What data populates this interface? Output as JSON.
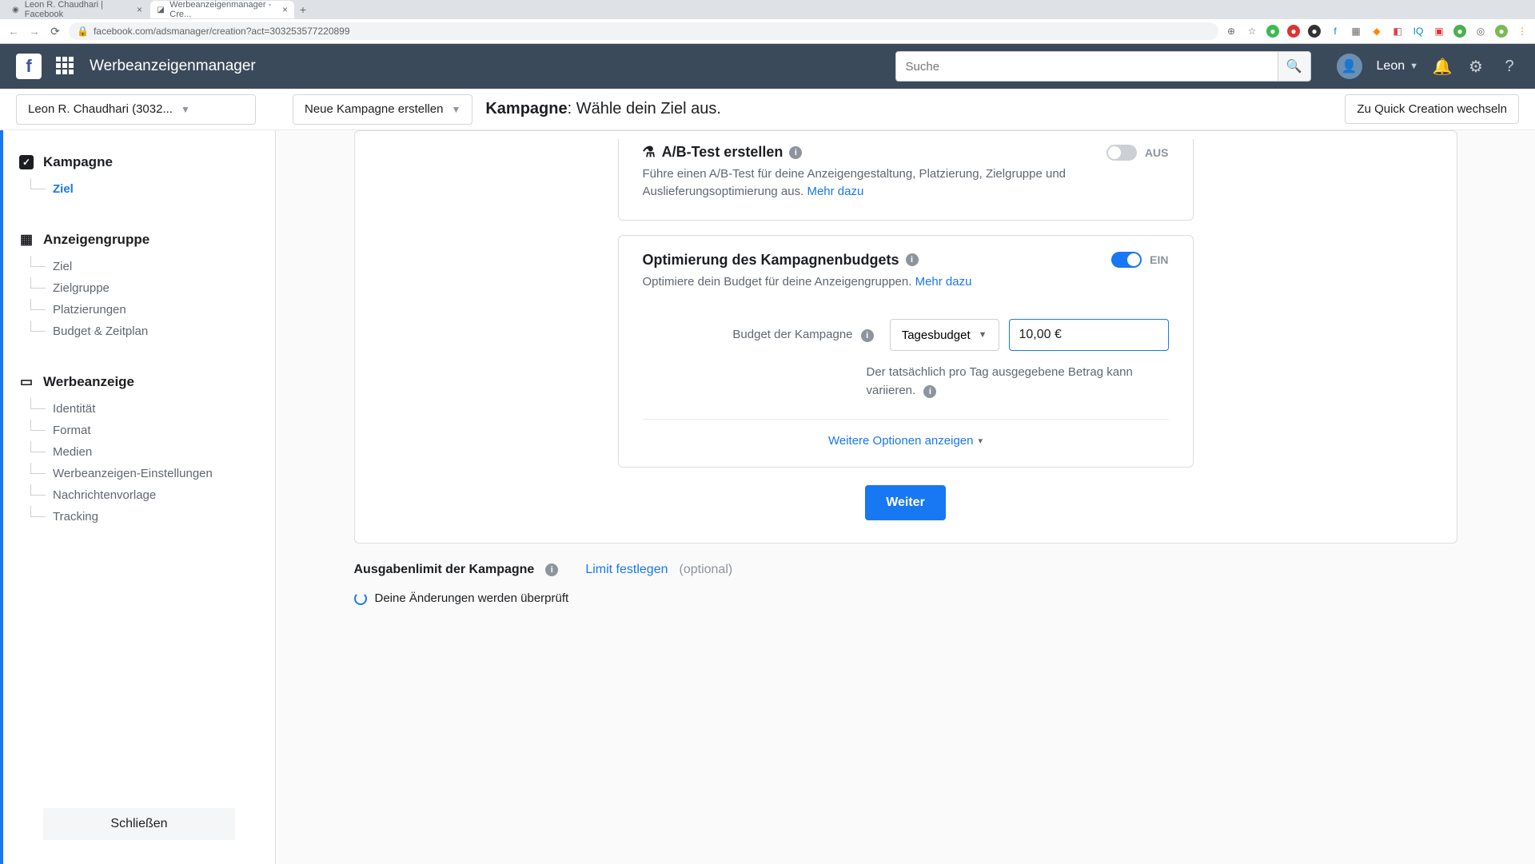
{
  "browser": {
    "tabs": [
      {
        "title": "Leon R. Chaudhari | Facebook"
      },
      {
        "title": "Werbeanzeigenmanager - Cre..."
      }
    ],
    "url": "facebook.com/adsmanager/creation?act=303253577220899"
  },
  "header": {
    "app_title": "Werbeanzeigenmanager",
    "search_placeholder": "Suche",
    "user_name": "Leon"
  },
  "page_header": {
    "account": "Leon R. Chaudhari (3032...",
    "create_campaign": "Neue Kampagne erstellen",
    "title_bold": "Kampagne",
    "title_rest": ": Wähle dein Ziel aus.",
    "switch_quick": "Zu Quick Creation wechseln"
  },
  "sidebar": {
    "section1": {
      "title": "Kampagne",
      "items": [
        "Ziel"
      ]
    },
    "section2": {
      "title": "Anzeigengruppe",
      "items": [
        "Ziel",
        "Zielgruppe",
        "Platzierungen",
        "Budget & Zeitplan"
      ]
    },
    "section3": {
      "title": "Werbeanzeige",
      "items": [
        "Identität",
        "Format",
        "Medien",
        "Werbeanzeigen-Einstellungen",
        "Nachrichtenvorlage",
        "Tracking"
      ]
    },
    "close": "Schließen"
  },
  "ab_test": {
    "title": "A/B-Test erstellen",
    "desc": "Führe einen A/B-Test für deine Anzeigengestaltung, Platzierung, Zielgruppe und Auslieferungsoptimierung aus.",
    "more": "Mehr dazu",
    "state": "AUS"
  },
  "budget_opt": {
    "title": "Optimierung des Kampagnenbudgets",
    "desc": "Optimiere dein Budget für deine Anzeigengruppen.",
    "more": "Mehr dazu",
    "state": "EIN",
    "row_label": "Budget der Kampagne",
    "select": "Tagesbudget",
    "value": "10,00 €",
    "note": "Der tatsächlich pro Tag ausgegebene Betrag kann variieren.",
    "more_options": "Weitere Optionen anzeigen"
  },
  "continue": "Weiter",
  "spend_limit": {
    "label": "Ausgabenlimit der Kampagne",
    "link": "Limit festlegen",
    "optional": "(optional)"
  },
  "review": "Deine Änderungen werden überprüft"
}
